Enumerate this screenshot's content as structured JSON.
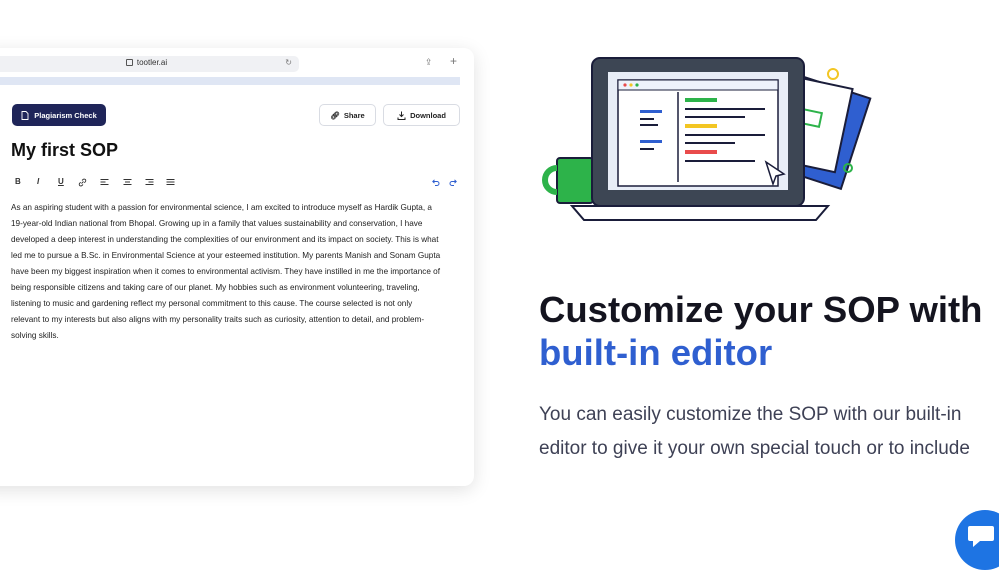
{
  "browser": {
    "url": "tootler.ai",
    "icons": {
      "lock": "lock-icon",
      "reload": "reload-icon",
      "share": "share-icon",
      "new_tab": "plus-icon"
    }
  },
  "editor": {
    "plagiarism_button": "Plagiarism Check",
    "share_button": "Share",
    "download_button": "Download",
    "doc_title": "My first SOP",
    "toolbar": [
      "B",
      "I",
      "U"
    ],
    "body": "As an aspiring student with a passion for environmental science, I am excited to introduce myself as Hardik Gupta, a 19-year-old Indian national from Bhopal. Growing up in a family that values sustainability and conservation, I have developed a deep interest in understanding the complexities of our environment and its impact on society. This is what led me to pursue a B.Sc. in Environmental Science at your esteemed institution. My parents Manish and Sonam Gupta have been my biggest inspiration when it comes to environmental activism. They have instilled in me the importance of being responsible citizens and taking care of our planet. My hobbies such as environment volunteering, traveling, listening to music and gardening reflect my personal commitment to this cause. The course selected is not only relevant to my interests but also aligns with my personality traits such as curiosity, attention to detail, and problem-solving skills."
  },
  "hero": {
    "headline_line1": "Customize your SOP with",
    "headline_line2": "built-in editor",
    "subtext_line1": "You can easily customize the SOP with our built-in",
    "subtext_line2": "editor to give it your own special touch or to include"
  },
  "colors": {
    "brand_navy": "#1f2559",
    "accent_blue": "#2f5fd0",
    "chat_blue": "#1e74e3"
  }
}
